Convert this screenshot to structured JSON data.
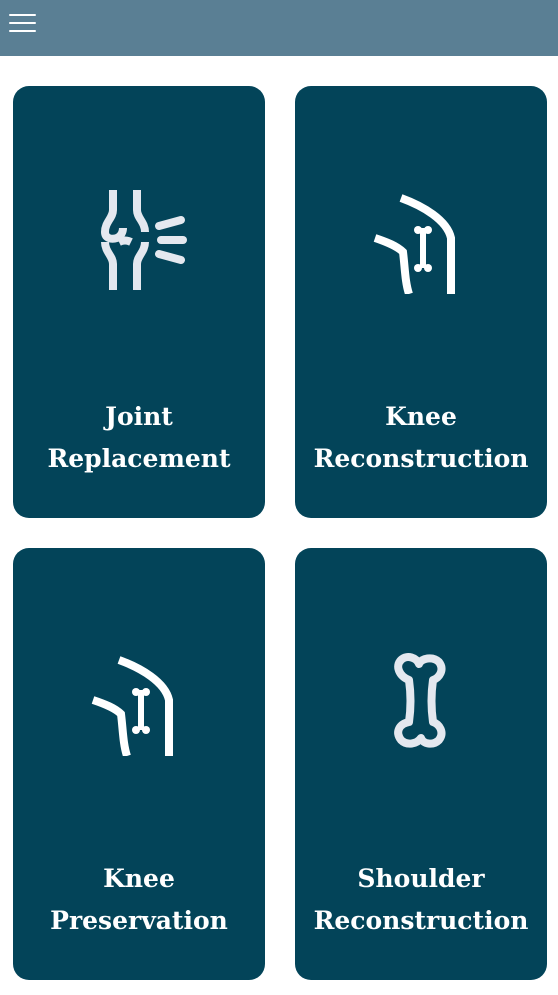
{
  "colors": {
    "header_bg": "#5a7f94",
    "card_bg": "#034459",
    "icon": "#e4e8ef",
    "text": "#ffffff"
  },
  "header": {
    "menu_icon": "hamburger-menu-icon"
  },
  "cards": [
    {
      "icon": "joint-icon",
      "label_line1": "Joint",
      "label_line2": "Replacement"
    },
    {
      "icon": "knee-bone-icon",
      "label_line1": "Knee",
      "label_line2": "Reconstruction"
    },
    {
      "icon": "knee-bone-icon",
      "label_line1": "Knee",
      "label_line2": "Preservation"
    },
    {
      "icon": "bone-icon",
      "label_line1": "Shoulder",
      "label_line2": "Reconstruction"
    }
  ]
}
